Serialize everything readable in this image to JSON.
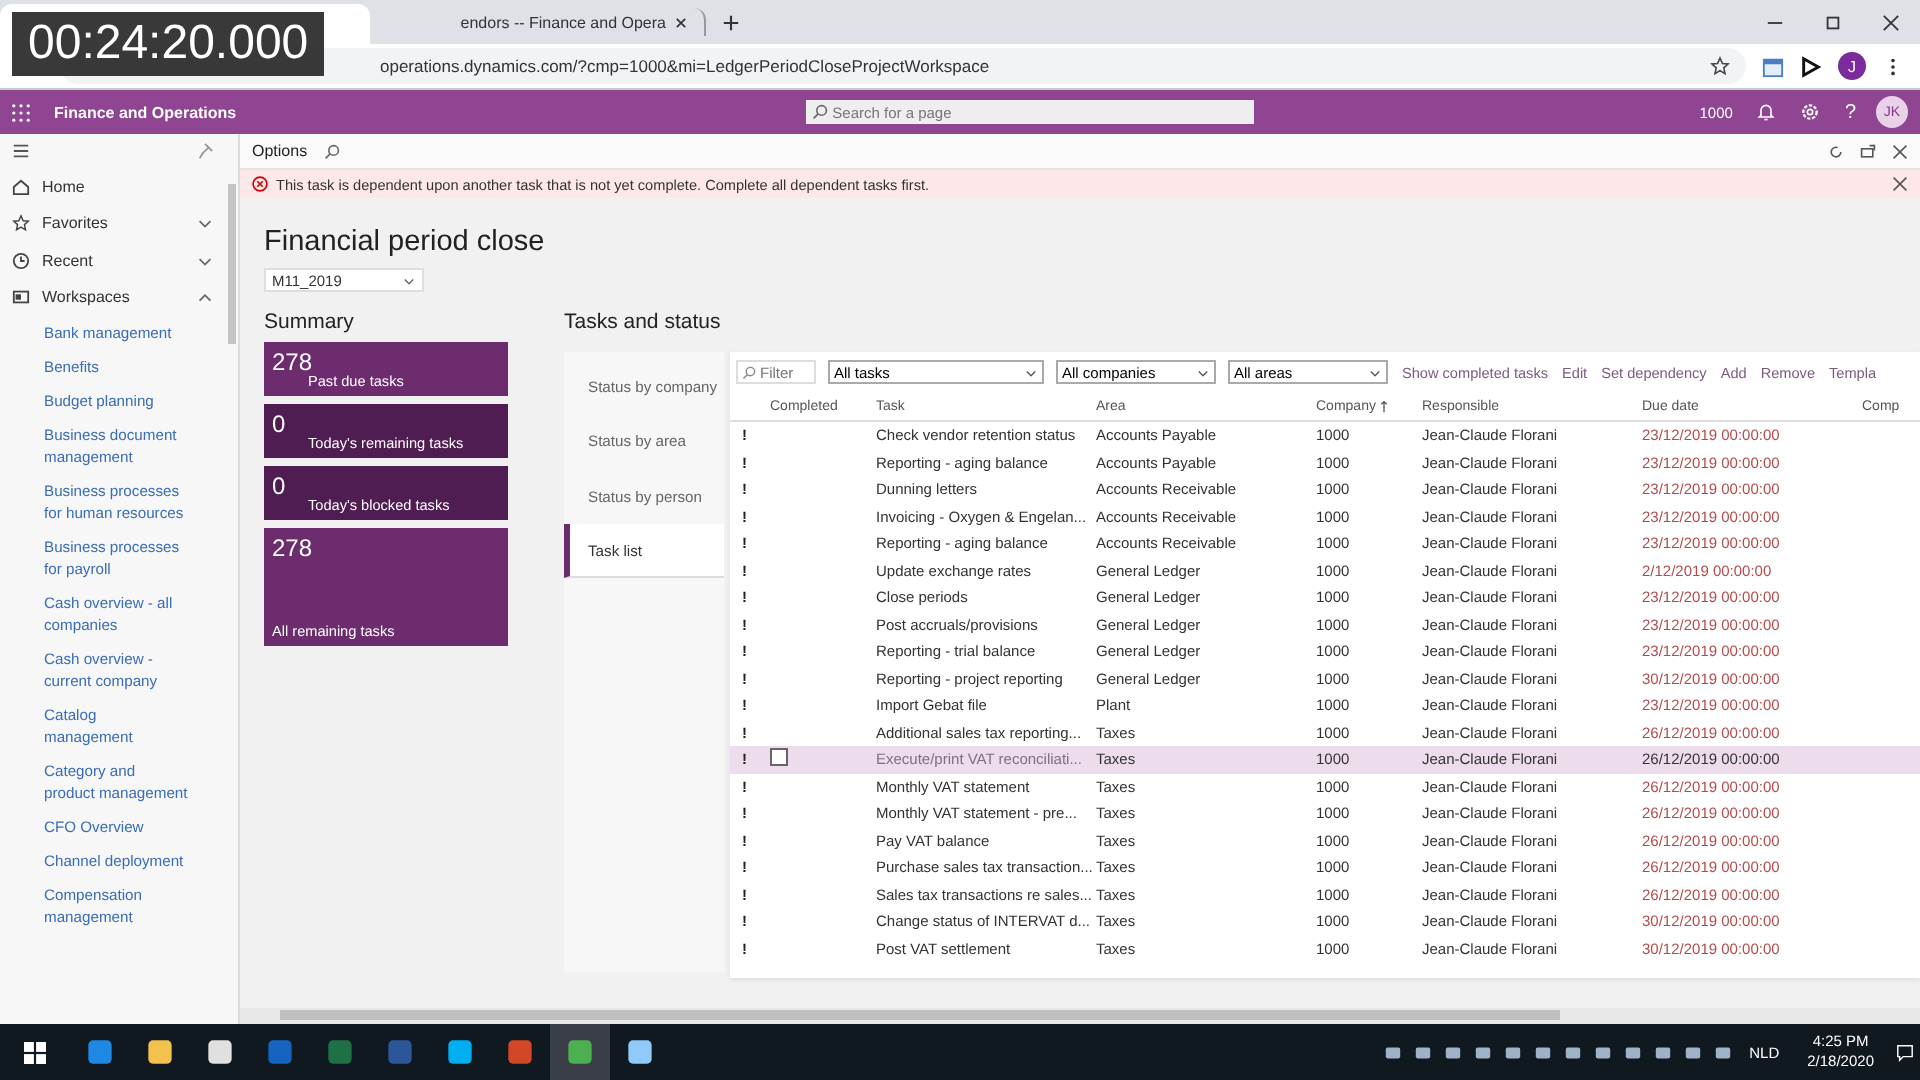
{
  "recording_timer": "00:24:20.000",
  "browser": {
    "tabs": [
      {
        "title": "endors -- Finance and Opera",
        "selected": false
      }
    ],
    "address": "operations.dynamics.com/?cmp=1000&mi=LedgerPeriodCloseProjectWorkspace",
    "profile": "J"
  },
  "app_bar": {
    "title": "Finance and Operations",
    "search": {
      "placeholder": "Search for a page"
    },
    "company": "1000",
    "help": "?",
    "avatar": "JK"
  },
  "options_bar": {
    "label": "Options"
  },
  "error": {
    "message": "This task is dependent upon another task that is not yet complete. Complete all dependent tasks first."
  },
  "nav": {
    "items": [
      {
        "label": "Home",
        "kind": "home"
      },
      {
        "label": "Favorites",
        "kind": "star",
        "expanded": false
      },
      {
        "label": "Recent",
        "kind": "clock",
        "expanded": false
      },
      {
        "label": "Workspaces",
        "kind": "workspace",
        "expanded": true
      }
    ],
    "links": [
      "Bank management",
      "Benefits",
      "Budget planning",
      "Business document management",
      "Business processes for human resources",
      "Business processes for payroll",
      "Cash overview - all companies",
      "Cash overview - current company",
      "Catalog management",
      "Category and product management",
      "CFO Overview",
      "Channel deployment",
      "Compensation management"
    ]
  },
  "page": {
    "title": "Financial period close",
    "period": "M11_2019"
  },
  "summary": {
    "title": "Summary",
    "tiles": [
      {
        "count": "278",
        "label": "Past due tasks",
        "color": "#6c2c6e",
        "kind": "small"
      },
      {
        "count": "0",
        "label": "Today's remaining tasks",
        "color": "#4f1d51",
        "kind": "small"
      },
      {
        "count": "0",
        "label": "Today's blocked tasks",
        "color": "#4f1d51",
        "kind": "small"
      },
      {
        "count": "278",
        "label": "All remaining tasks",
        "color": "#6c2c6e",
        "kind": "large"
      }
    ]
  },
  "tasks": {
    "title": "Tasks and status",
    "tabs": [
      {
        "label": "Status by company",
        "selected": false
      },
      {
        "label": "Status by area",
        "selected": false
      },
      {
        "label": "Status by person",
        "selected": false
      },
      {
        "label": "Task list",
        "selected": true
      }
    ],
    "filter": {
      "placeholder": "Filter"
    },
    "dropdowns": [
      "All tasks",
      "All companies",
      "All areas"
    ],
    "actions": [
      "Show completed tasks",
      "Edit",
      "Set dependency",
      "Add",
      "Remove",
      "Templa"
    ],
    "columns": [
      "Completed",
      "Task",
      "Area",
      "Company",
      "Responsible",
      "Due date",
      "Comp"
    ],
    "rows": [
      {
        "flag": "!",
        "task": "Check vendor retention status",
        "area": "Accounts Payable",
        "company": "1000",
        "responsible": "Jean-Claude Florani",
        "due": "23/12/2019 00:00:00",
        "selected": false
      },
      {
        "flag": "!",
        "task": "Reporting - aging balance",
        "area": "Accounts Payable",
        "company": "1000",
        "responsible": "Jean-Claude Florani",
        "due": "23/12/2019 00:00:00",
        "selected": false
      },
      {
        "flag": "!",
        "task": "Dunning letters",
        "area": "Accounts Receivable",
        "company": "1000",
        "responsible": "Jean-Claude Florani",
        "due": "23/12/2019 00:00:00",
        "selected": false
      },
      {
        "flag": "!",
        "task": "Invoicing - Oxygen & Engelan...",
        "area": "Accounts Receivable",
        "company": "1000",
        "responsible": "Jean-Claude Florani",
        "due": "23/12/2019 00:00:00",
        "selected": false
      },
      {
        "flag": "!",
        "task": "Reporting - aging balance",
        "area": "Accounts Receivable",
        "company": "1000",
        "responsible": "Jean-Claude Florani",
        "due": "23/12/2019 00:00:00",
        "selected": false
      },
      {
        "flag": "!",
        "task": "Update exchange rates",
        "area": "General Ledger",
        "company": "1000",
        "responsible": "Jean-Claude Florani",
        "due": "2/12/2019 00:00:00",
        "selected": false
      },
      {
        "flag": "!",
        "task": "Close periods",
        "area": "General Ledger",
        "company": "1000",
        "responsible": "Jean-Claude Florani",
        "due": "23/12/2019 00:00:00",
        "selected": false
      },
      {
        "flag": "!",
        "task": "Post accruals/provisions",
        "area": "General Ledger",
        "company": "1000",
        "responsible": "Jean-Claude Florani",
        "due": "23/12/2019 00:00:00",
        "selected": false
      },
      {
        "flag": "!",
        "task": "Reporting - trial balance",
        "area": "General Ledger",
        "company": "1000",
        "responsible": "Jean-Claude Florani",
        "due": "23/12/2019 00:00:00",
        "selected": false
      },
      {
        "flag": "!",
        "task": "Reporting - project reporting",
        "area": "General Ledger",
        "company": "1000",
        "responsible": "Jean-Claude Florani",
        "due": "30/12/2019 00:00:00",
        "selected": false
      },
      {
        "flag": "!",
        "task": "Import Gebat file",
        "area": "Plant",
        "company": "1000",
        "responsible": "Jean-Claude Florani",
        "due": "23/12/2019 00:00:00",
        "selected": false
      },
      {
        "flag": "!",
        "task": "Additional sales tax reporting...",
        "area": "Taxes",
        "company": "1000",
        "responsible": "Jean-Claude Florani",
        "due": "26/12/2019 00:00:00",
        "selected": false
      },
      {
        "flag": "!",
        "task": "Execute/print VAT reconciliati...",
        "area": "Taxes",
        "company": "1000",
        "responsible": "Jean-Claude Florani",
        "due": "26/12/2019 00:00:00",
        "selected": true
      },
      {
        "flag": "!",
        "task": "Monthly VAT statement",
        "area": "Taxes",
        "company": "1000",
        "responsible": "Jean-Claude Florani",
        "due": "26/12/2019 00:00:00",
        "selected": false
      },
      {
        "flag": "!",
        "task": "Monthly VAT statement - pre...",
        "area": "Taxes",
        "company": "1000",
        "responsible": "Jean-Claude Florani",
        "due": "26/12/2019 00:00:00",
        "selected": false
      },
      {
        "flag": "!",
        "task": "Pay VAT balance",
        "area": "Taxes",
        "company": "1000",
        "responsible": "Jean-Claude Florani",
        "due": "26/12/2019 00:00:00",
        "selected": false
      },
      {
        "flag": "!",
        "task": "Purchase sales tax transaction...",
        "area": "Taxes",
        "company": "1000",
        "responsible": "Jean-Claude Florani",
        "due": "26/12/2019 00:00:00",
        "selected": false
      },
      {
        "flag": "!",
        "task": "Sales tax transactions re sales...",
        "area": "Taxes",
        "company": "1000",
        "responsible": "Jean-Claude Florani",
        "due": "26/12/2019 00:00:00",
        "selected": false
      },
      {
        "flag": "!",
        "task": "Change status of INTERVAT d...",
        "area": "Taxes",
        "company": "1000",
        "responsible": "Jean-Claude Florani",
        "due": "30/12/2019 00:00:00",
        "selected": false
      },
      {
        "flag": "!",
        "task": "Post VAT settlement",
        "area": "Taxes",
        "company": "1000",
        "responsible": "Jean-Claude Florani",
        "due": "30/12/2019 00:00:00",
        "selected": false
      }
    ]
  },
  "taskbar": {
    "apps": [
      {
        "color": "#1e88e5",
        "selected": false
      },
      {
        "color": "#f2c14e",
        "selected": false
      },
      {
        "color": "#e0e0e0",
        "selected": false
      },
      {
        "color": "#1565c0",
        "selected": false
      },
      {
        "color": "#1e7145",
        "selected": false
      },
      {
        "color": "#2b579a",
        "selected": false
      },
      {
        "color": "#00aff0",
        "selected": false
      },
      {
        "color": "#d24726",
        "selected": false
      },
      {
        "color": "#4caf50",
        "selected": true
      },
      {
        "color": "#90caf9",
        "selected": false
      }
    ],
    "language": "NLD",
    "time": "4:25 PM",
    "date": "2/18/2020"
  }
}
